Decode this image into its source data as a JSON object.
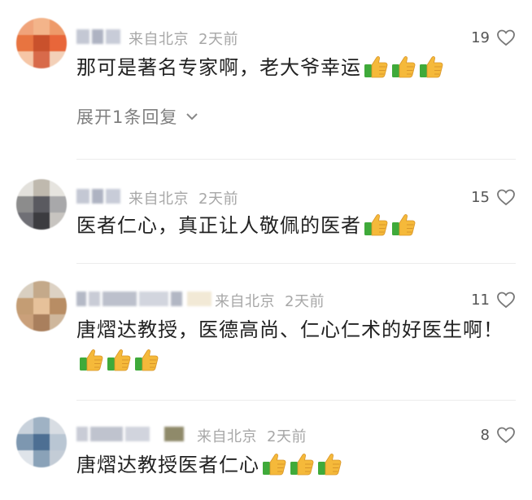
{
  "comments": [
    {
      "meta_location": "来自北京",
      "meta_time": "2天前",
      "likes": "19",
      "text": "那可是著名专家啊，老大爷幸运",
      "thumbs_count": 3,
      "expand_label": "展开1条回复"
    },
    {
      "meta_location": "来自北京",
      "meta_time": "2天前",
      "likes": "15",
      "text": "医者仁心，真正让人敬佩的医者",
      "thumbs_count": 2
    },
    {
      "meta_location": "来自北京",
      "meta_time": "2天前",
      "likes": "11",
      "text": "唐熠达教授，医德高尚、仁心仁术的好医生啊！",
      "thumbs_count": 3
    },
    {
      "meta_location": "来自北京",
      "meta_time": "2天前",
      "likes": "8",
      "text": "唐熠达教授医者仁心",
      "thumbs_count": 3
    }
  ],
  "colors": {
    "meta_gray": "#a7a7a7",
    "text_dark": "#222222",
    "thumb_yellow": "#f5b93a",
    "thumb_cuff": "#3faa3a"
  }
}
